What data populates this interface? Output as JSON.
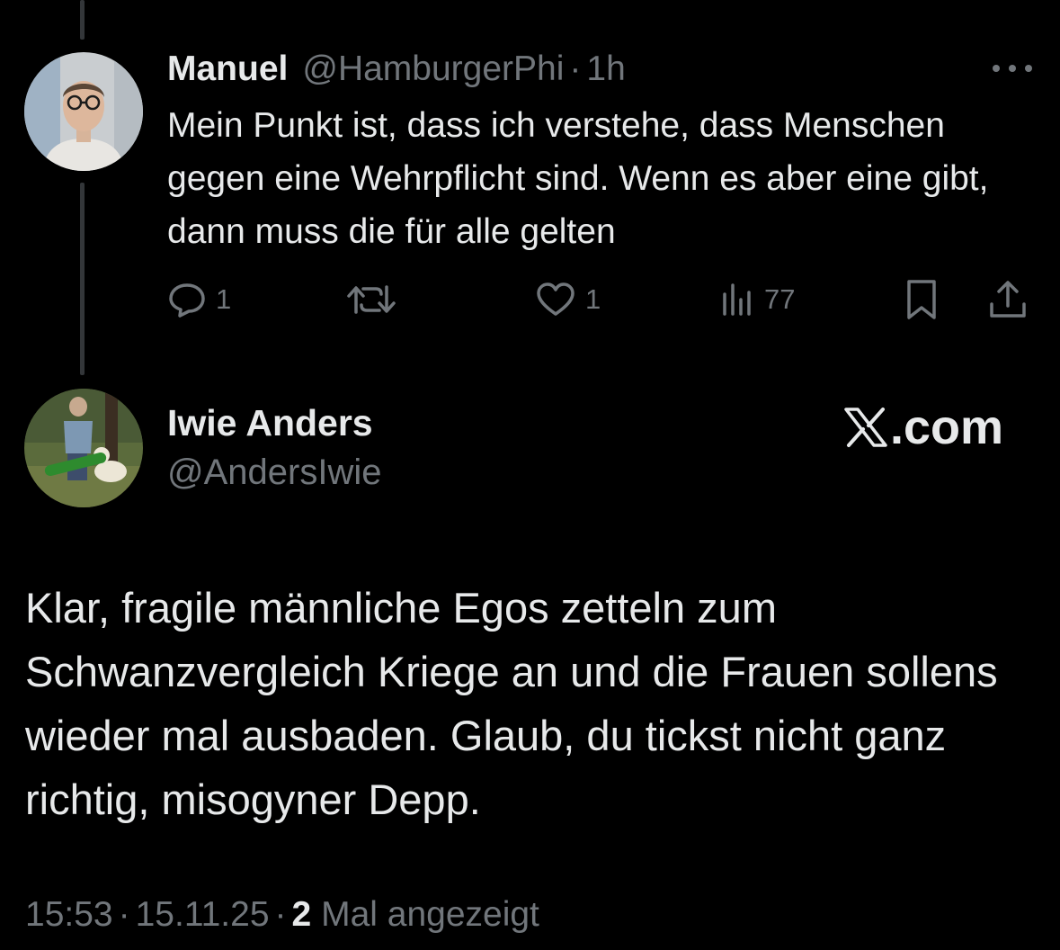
{
  "parent_tweet": {
    "name": "Manuel",
    "handle": "@HamburgerPhi",
    "separator": "·",
    "time": "1h",
    "text": "Mein Punkt ist, dass ich verstehe, dass Menschen gegen eine Wehrpflicht sind. Wenn es aber eine gibt, dann muss die für alle gelten",
    "actions": {
      "reply_icon": "reply-icon",
      "reply_count": "1",
      "retweet_icon": "retweet-icon",
      "like_icon": "heart-icon",
      "like_count": "1",
      "views_icon": "views-icon",
      "views_count": "77",
      "bookmark_icon": "bookmark-icon",
      "share_icon": "share-icon"
    },
    "more_icon": "more-icon"
  },
  "reply_tweet": {
    "name": "Iwie Anders",
    "handle": "@AndersIwie",
    "text": "Klar, fragile männliche Egos zetteln zum Schwanzvergleich Kriege an und die Frauen sollens wieder mal ausbaden. Glaub, du tickst nicht ganz richtig, misogyner Depp."
  },
  "brand": {
    "logo_icon": "x-logo-icon",
    "suffix": ".com"
  },
  "meta": {
    "time": "15:53",
    "sep1": "·",
    "date": "15.11.25",
    "sep2": "·",
    "views_count": "2",
    "views_label": "Mal angezeigt"
  },
  "colors": {
    "background": "#000000",
    "primary_text": "#e7e9ea",
    "secondary_text": "#71767b",
    "thread_line": "#333639"
  }
}
